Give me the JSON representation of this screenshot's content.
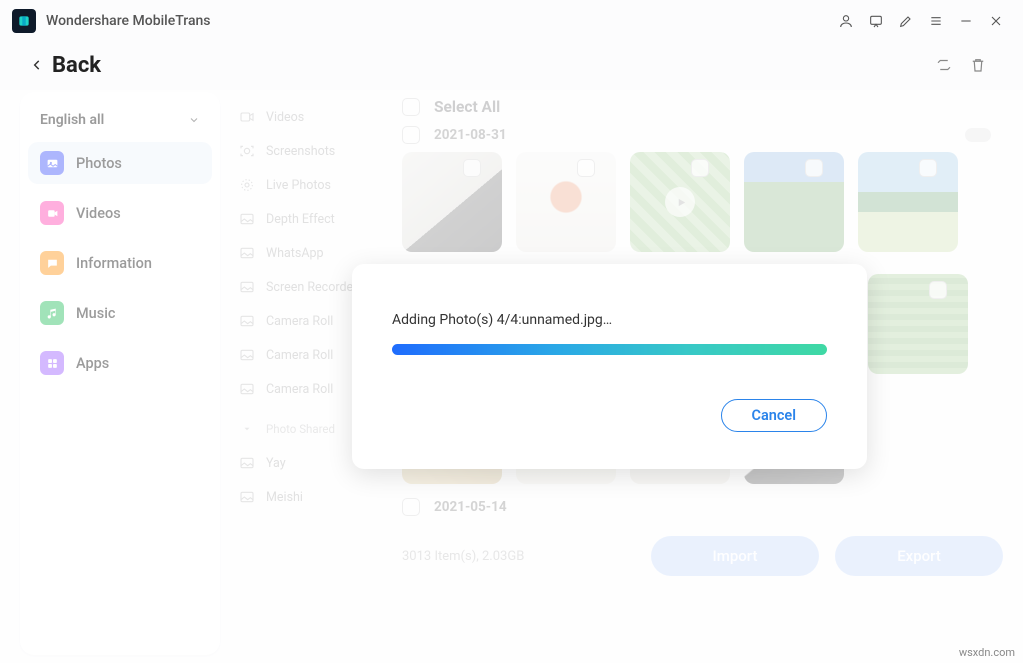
{
  "app": {
    "name": "Wondershare MobileTrans"
  },
  "back": {
    "label": "Back"
  },
  "dropdown": {
    "label": "English all"
  },
  "sidebar": {
    "items": [
      {
        "label": "Photos"
      },
      {
        "label": "Videos"
      },
      {
        "label": "Information"
      },
      {
        "label": "Music"
      },
      {
        "label": "Apps"
      }
    ]
  },
  "albums": {
    "items": [
      "Videos",
      "Screenshots",
      "Live Photos",
      "Depth Effect",
      "WhatsApp",
      "Screen Recorder",
      "Camera Roll",
      "Camera Roll",
      "Camera Roll"
    ],
    "sep": "Photo Shared",
    "extra": [
      "Yay",
      "Meishi"
    ]
  },
  "content": {
    "selectAll": "Select All",
    "date1": "2021-08-31",
    "date2": "2021-05-14",
    "footer": "3013 Item(s), 2.03GB",
    "importLabel": "Import",
    "exportLabel": "Export"
  },
  "modal": {
    "text": "Adding Photo(s) 4/4:unnamed.jpg…",
    "cancel": "Cancel"
  },
  "watermark": "wsxdn.com"
}
